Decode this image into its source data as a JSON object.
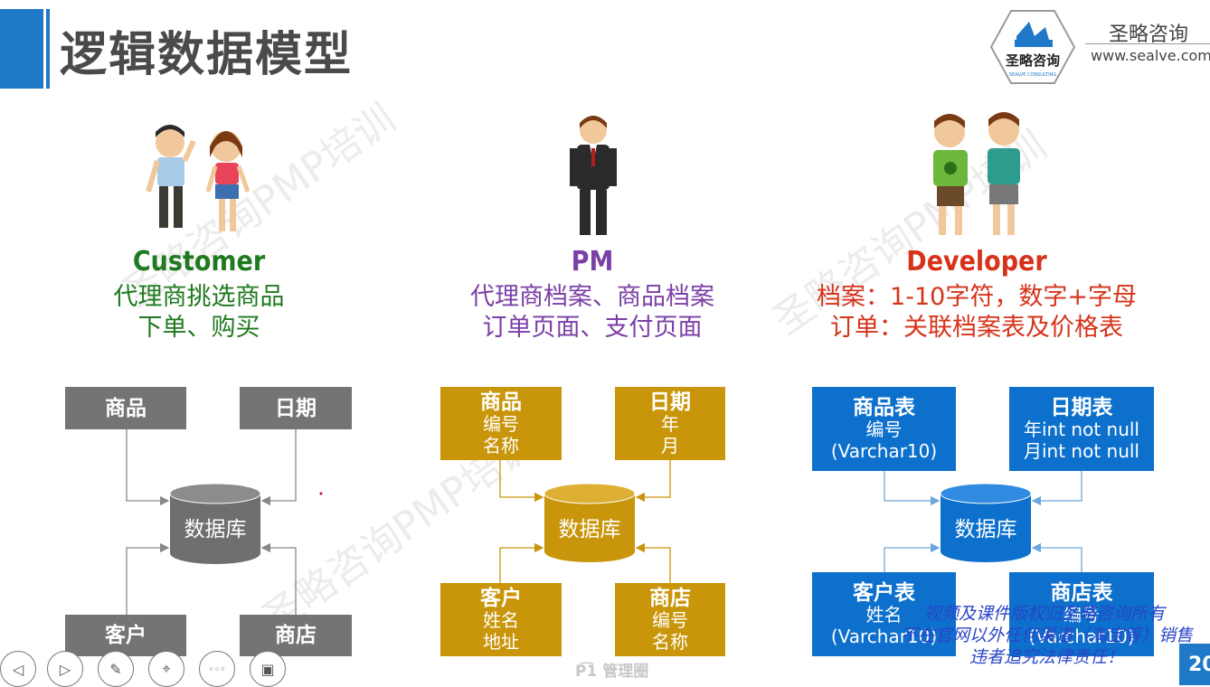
{
  "slide": {
    "title": "逻辑数据模型",
    "brand_name": "圣略咨询",
    "brand_url": "www.sealve.com",
    "logo_text": "圣略咨询",
    "logo_sub": "SEALVE CONSULTING",
    "page_number": "20",
    "watermark": "圣略咨询PMP培训",
    "bottom_mark": "管理圈"
  },
  "columns": [
    {
      "role": "Customer",
      "color": "#1f7a1f",
      "desc": [
        "代理商挑选商品",
        "下单、购买"
      ]
    },
    {
      "role": "PM",
      "color": "#7b3fa6",
      "desc": [
        "代理商档案、商品档案",
        "订单页面、支付页面"
      ]
    },
    {
      "role": "Developer",
      "color": "#d6331a",
      "desc": [
        "档案：1-10字符，数字+字母",
        "订单：关联档案表及价格表"
      ]
    }
  ],
  "diagrams": {
    "customer": {
      "tl": {
        "h": "商品"
      },
      "tr": {
        "h": "日期"
      },
      "bl": {
        "h": "客户"
      },
      "br": {
        "h": "商店"
      },
      "db": "数据库"
    },
    "pm": {
      "tl": {
        "h": "商品",
        "l1": "编号",
        "l2": "名称"
      },
      "tr": {
        "h": "日期",
        "l1": "年",
        "l2": "月"
      },
      "bl": {
        "h": "客户",
        "l1": "姓名",
        "l2": "地址"
      },
      "br": {
        "h": "商店",
        "l1": "编号",
        "l2": "名称"
      },
      "db": "数据库"
    },
    "developer": {
      "tl": {
        "h": "商品表",
        "l1": "编号",
        "l2": "(Varchar10)"
      },
      "tr": {
        "h": "日期表",
        "l1": "年int not null",
        "l2": "月int not null"
      },
      "bl": {
        "h": "客户表",
        "l1": "姓名",
        "l2": "(Varchar10)"
      },
      "br": {
        "h": "商店表",
        "l1": "编号",
        "l2": "(Varchar10)"
      },
      "db": "数据库"
    }
  },
  "notice": [
    "视频及课件版权归圣略咨询所有",
    "不在官网以外任何渠道（淘宝等）销售",
    "违者追究法律责任！"
  ],
  "controls": [
    {
      "name": "prev-icon",
      "glyph": "◁"
    },
    {
      "name": "next-icon",
      "glyph": "▷"
    },
    {
      "name": "pen-icon",
      "glyph": "✎"
    },
    {
      "name": "pointer-icon",
      "glyph": "⌖"
    },
    {
      "name": "more-icon",
      "glyph": "◦◦◦"
    },
    {
      "name": "screen-icon",
      "glyph": "▣"
    }
  ]
}
